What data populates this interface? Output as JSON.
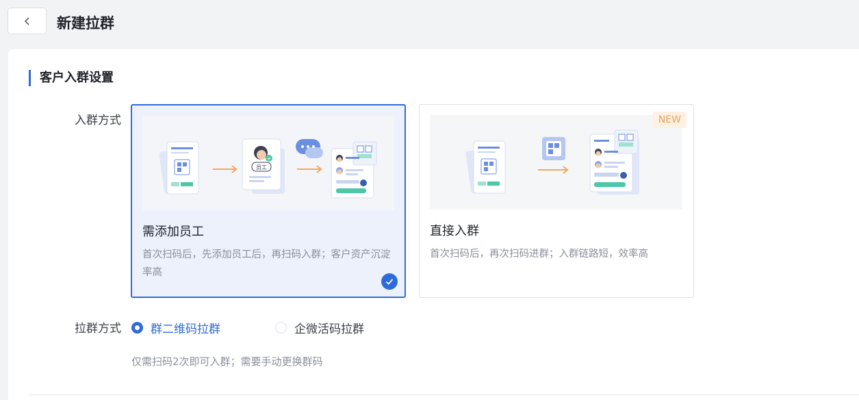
{
  "header": {
    "back_icon": "chevron-left-icon",
    "title": "新建拉群"
  },
  "section": {
    "title": "客户入群设置"
  },
  "join_method": {
    "label": "入群方式",
    "options": [
      {
        "title": "需添加员工",
        "desc": "首次扫码后，先添加员工后，再扫码入群；客户资产沉淀率高",
        "illustration_tag": "员工",
        "selected": true,
        "check_icon": "check-icon"
      },
      {
        "title": "直接入群",
        "desc": "首次扫码后，再次扫码进群；入群链路短，效率高",
        "badge": "NEW",
        "selected": false
      }
    ]
  },
  "pull_method": {
    "label": "拉群方式",
    "options": [
      {
        "label": "群二维码拉群",
        "checked": true
      },
      {
        "label": "企微活码拉群",
        "checked": false
      }
    ],
    "hint": "仅需扫码2次即可入群；需要手动更换群码"
  },
  "colors": {
    "accent": "#2f6bd8",
    "background": "#f2f3f5",
    "new_badge_bg": "#fdf1e4",
    "new_badge_text": "#e8a25c",
    "arrow": "#f5a75c",
    "teal": "#4cc7a8"
  }
}
